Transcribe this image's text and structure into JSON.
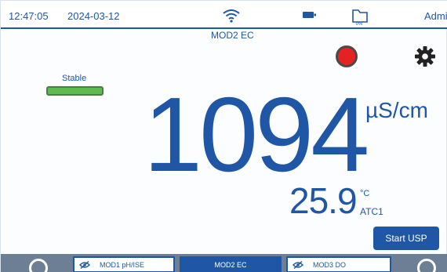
{
  "status_bar": {
    "time": "12:47:05",
    "date": "2024-03-12",
    "wifi_icon": "wifi-icon",
    "battery_icon": "battery-icon",
    "storage_icon": "folder-icon",
    "storage_percent": "0%",
    "user": "Admi"
  },
  "module_title": "MOD2 EC",
  "controls": {
    "record_icon": "record-icon",
    "record_color": "#e62121",
    "settings_icon": "gear-icon"
  },
  "stability": {
    "label": "Stable",
    "color": "#5dbb4f"
  },
  "measurement": {
    "value": "1094",
    "unit": "µS/cm"
  },
  "temperature": {
    "value": "25.9",
    "unit": "°C",
    "sensor": "ATC1"
  },
  "actions": {
    "start_usp_label": "Start USP"
  },
  "tabs": [
    {
      "label": "MOD1 pH/ISE",
      "icon": "hidden-eye-icon",
      "active": false
    },
    {
      "label": "MOD2 EC",
      "active": true
    },
    {
      "label": "MOD3 DO",
      "icon": "hidden-eye-icon",
      "active": false
    }
  ],
  "theme": {
    "primary": "#1f57a6",
    "tabbar": "#6d7f94"
  }
}
